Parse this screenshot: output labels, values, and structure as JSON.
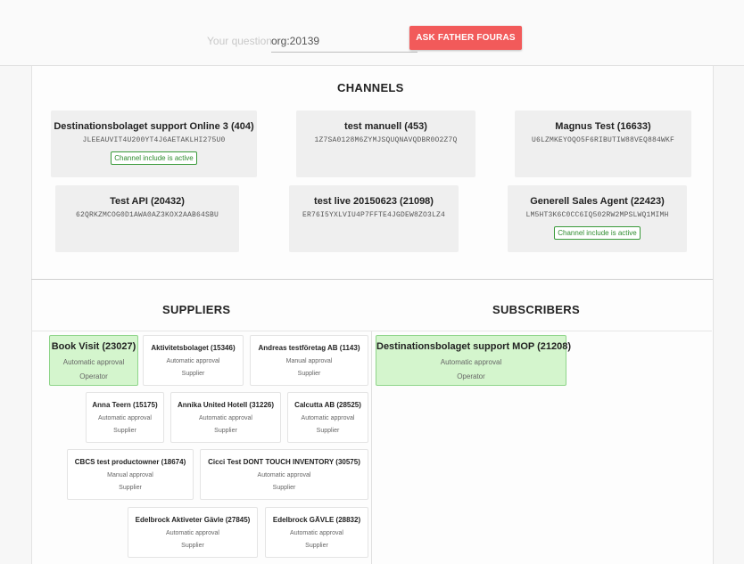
{
  "header": {
    "question_label": "Your question:",
    "question_value": "org:20139",
    "ask_button": "ASK FATHER FOURAS"
  },
  "sections": {
    "channels": "CHANNELS",
    "suppliers": "SUPPLIERS",
    "subscribers": "SUBSCRIBERS"
  },
  "channels": [
    {
      "name": "Destinationsbolaget support Online 3 (404)",
      "key": "JLEEAUVIT4U200YT4J6AETAKLHI275U0",
      "badge": "Channel include is active"
    },
    {
      "name": "test manuell (453)",
      "key": "1Z7SA0128M6ZYMJSQUQNAVQDBR0O2Z7Q",
      "badge": ""
    },
    {
      "name": "Magnus Test (16633)",
      "key": "U6LZMKEYOQO5F6RIBUTIW88VEQ884WKF",
      "badge": ""
    },
    {
      "name": "Test API (20432)",
      "key": "62QRKZMCOG0D1AWA0AZ3KOX2AAB64SBU",
      "badge": ""
    },
    {
      "name": "test live 20150623 (21098)",
      "key": "ER76I5YXLVIU4P7FFTE4JGDEW8ZO3LZ4",
      "badge": ""
    },
    {
      "name": "Generell Sales Agent (22423)",
      "key": "LM5HT3K6C0CC6IQ502RW2MPSLWQ1MIMH",
      "badge": "Channel include is active"
    }
  ],
  "suppliers": [
    {
      "name": "Book Visit (23027)",
      "approval": "Automatic approval",
      "role": "Operator"
    },
    {
      "name": "Aktivitetsbolaget (15346)",
      "approval": "Automatic approval",
      "role": "Supplier"
    },
    {
      "name": "Andreas testföretag AB (1143)",
      "approval": "Manual approval",
      "role": "Supplier"
    },
    {
      "name": "Anna Teern (15175)",
      "approval": "Automatic approval",
      "role": "Supplier"
    },
    {
      "name": "Annika United Hotell (31226)",
      "approval": "Automatic approval",
      "role": "Supplier"
    },
    {
      "name": "Calcutta AB (28525)",
      "approval": "Automatic approval",
      "role": "Supplier"
    },
    {
      "name": "CBCS test productowner (18674)",
      "approval": "Manual approval",
      "role": "Supplier"
    },
    {
      "name": "Cicci Test DONT TOUCH INVENTORY (30575)",
      "approval": "Automatic approval",
      "role": "Supplier"
    },
    {
      "name": "Edelbrock Aktiveter Gävle (27845)",
      "approval": "Automatic approval",
      "role": "Supplier"
    },
    {
      "name": "Edelbrock GÄVLE (28832)",
      "approval": "Automatic approval",
      "role": "Supplier"
    }
  ],
  "subscribers": [
    {
      "name": "Destinationsbolaget support MOP (21208)",
      "approval": "Automatic approval",
      "role": "Operator"
    }
  ]
}
